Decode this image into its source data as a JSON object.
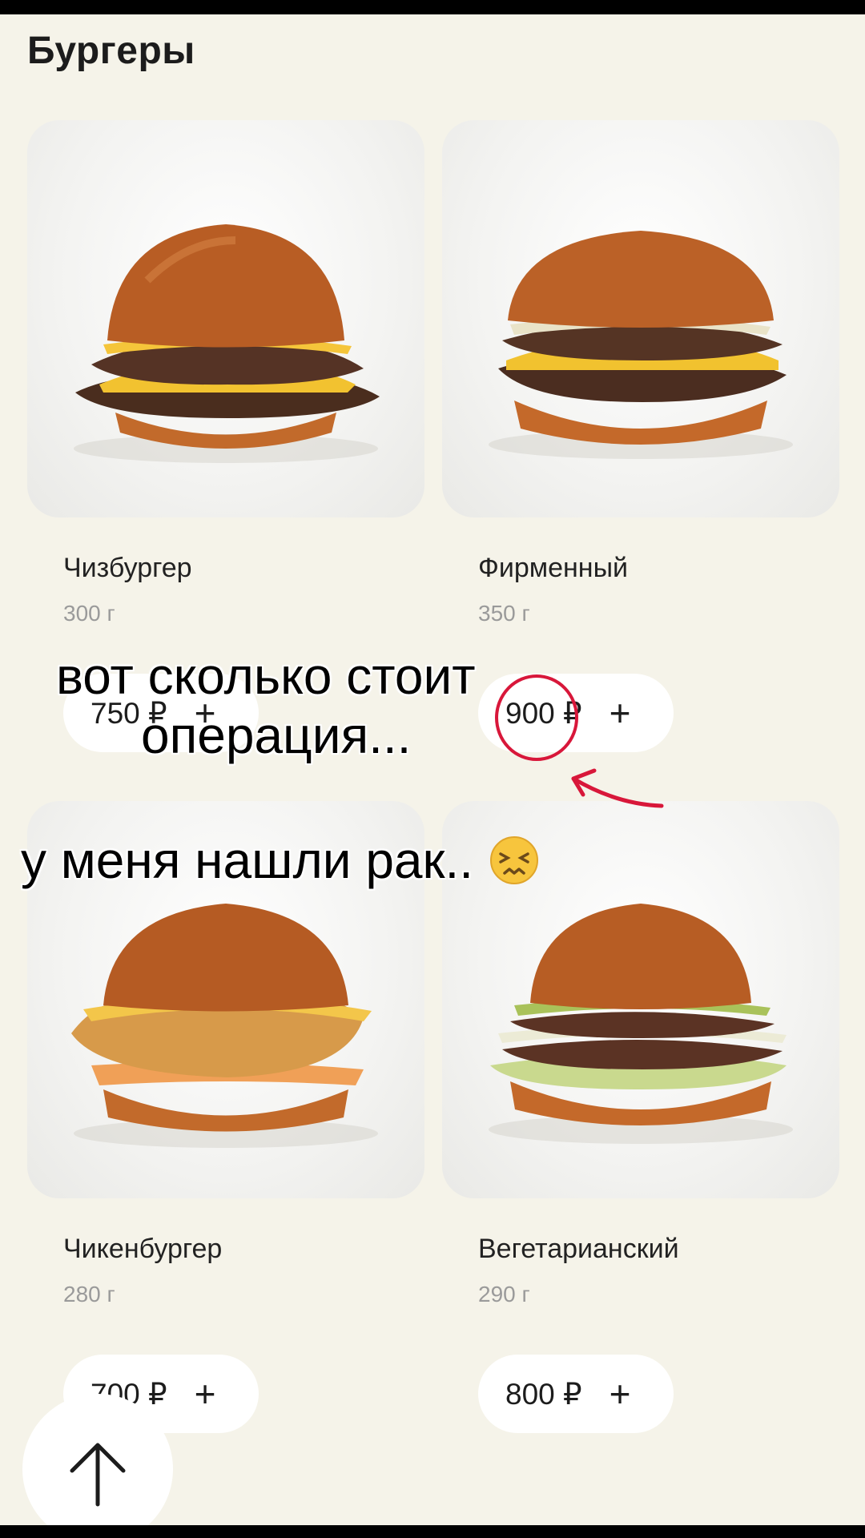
{
  "section": {
    "title": "Бургеры"
  },
  "products": [
    {
      "name": "Чизбургер",
      "weight": "300 г",
      "price": "750 ₽",
      "add_icon": "+"
    },
    {
      "name": "Фирменный",
      "weight": "350 г",
      "price": "900 ₽",
      "add_icon": "+"
    },
    {
      "name": "Чикенбургер",
      "weight": "280 г",
      "price": "700 ₽",
      "add_icon": "+"
    },
    {
      "name": "Вегетарианский",
      "weight": "290 г",
      "price": "800 ₽",
      "add_icon": "+"
    }
  ],
  "overlay": {
    "line1": "вот сколько стоит",
    "line2": "операция...",
    "line3": "у меня нашли рак.."
  },
  "icons": {
    "scroll_top": "arrow-up-icon",
    "add": "plus-icon",
    "emoji": "confounded-face-icon"
  },
  "colors": {
    "background": "#f5f3e9",
    "pill": "#ffffff",
    "annotation": "#d8173a"
  }
}
